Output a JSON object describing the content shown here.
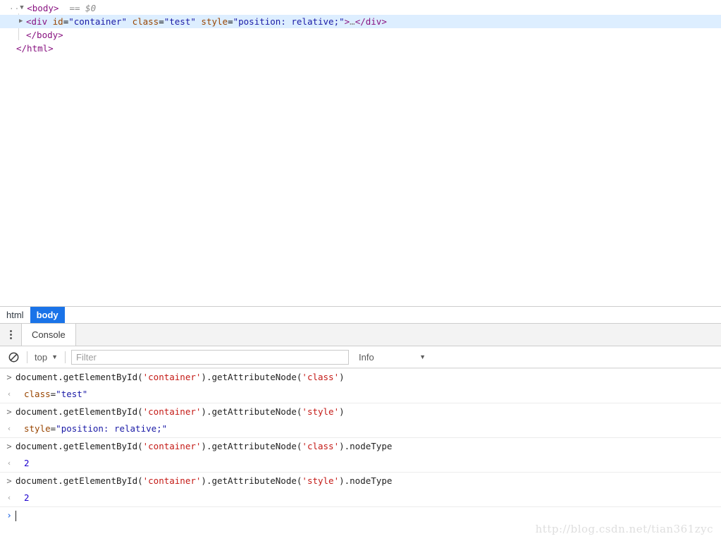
{
  "elements_panel": {
    "rows": [
      {
        "indent": 0,
        "twisty": "open",
        "leading_dots": "··",
        "selected": false,
        "segments": [
          {
            "cls": "t-tag",
            "text": "<body>"
          },
          {
            "cls": "t-plain",
            "text": "  "
          },
          {
            "cls": "t-comment",
            "text": "== $0"
          }
        ]
      },
      {
        "indent": 1,
        "twisty": "closed",
        "leading_dots": "",
        "selected": true,
        "segments": [
          {
            "cls": "t-tag",
            "text": "<div"
          },
          {
            "cls": "t-plain",
            "text": " "
          },
          {
            "cls": "t-attrname",
            "text": "id"
          },
          {
            "cls": "t-punct2",
            "text": "="
          },
          {
            "cls": "t-attrval",
            "text": "\"container\""
          },
          {
            "cls": "t-plain",
            "text": " "
          },
          {
            "cls": "t-attrname",
            "text": "class"
          },
          {
            "cls": "t-punct2",
            "text": "="
          },
          {
            "cls": "t-attrval",
            "text": "\"test\""
          },
          {
            "cls": "t-plain",
            "text": " "
          },
          {
            "cls": "t-attrname",
            "text": "style"
          },
          {
            "cls": "t-punct2",
            "text": "="
          },
          {
            "cls": "t-attrval",
            "text": "\"position: relative;\""
          },
          {
            "cls": "t-tag",
            "text": ">"
          },
          {
            "cls": "t-elide",
            "text": "…"
          },
          {
            "cls": "t-tag",
            "text": "</div>"
          }
        ]
      },
      {
        "indent": 1,
        "twisty": "none",
        "leading_dots": "",
        "selected": false,
        "segments": [
          {
            "cls": "t-tag",
            "text": "</body>"
          }
        ]
      },
      {
        "indent": 0,
        "twisty": "none",
        "leading_dots": "",
        "selected": false,
        "segments": [
          {
            "cls": "t-tag",
            "text": "</html>"
          }
        ]
      }
    ]
  },
  "breadcrumb": {
    "items": [
      {
        "label": "html",
        "active": false
      },
      {
        "label": "body",
        "active": true
      }
    ]
  },
  "drawer": {
    "kebab_icon": "more-vertical-icon",
    "tabs": [
      {
        "label": "Console",
        "active": true
      }
    ]
  },
  "console_toolbar": {
    "clear_icon": "clear-console-icon",
    "context_label": "top",
    "context_caret": "▼",
    "filter_placeholder": "Filter",
    "filter_value": "",
    "level_label": "Info",
    "level_caret": "▼"
  },
  "console_messages": [
    {
      "type": "command",
      "gutter": ">",
      "segments": [
        {
          "cls": "c-plain",
          "text": "document.getElementById("
        },
        {
          "cls": "c-str",
          "text": "'container'"
        },
        {
          "cls": "c-plain",
          "text": ").getAttributeNode("
        },
        {
          "cls": "c-str",
          "text": "'class'"
        },
        {
          "cls": "c-plain",
          "text": ")"
        }
      ]
    },
    {
      "type": "result",
      "gutter": "‹",
      "segments": [
        {
          "cls": "c-attrname",
          "text": "class"
        },
        {
          "cls": "c-plain",
          "text": "="
        },
        {
          "cls": "c-attrval",
          "text": "\"test\""
        }
      ]
    },
    {
      "type": "command",
      "gutter": ">",
      "segments": [
        {
          "cls": "c-plain",
          "text": "document.getElementById("
        },
        {
          "cls": "c-str",
          "text": "'container'"
        },
        {
          "cls": "c-plain",
          "text": ").getAttributeNode("
        },
        {
          "cls": "c-str",
          "text": "'style'"
        },
        {
          "cls": "c-plain",
          "text": ")"
        }
      ]
    },
    {
      "type": "result",
      "gutter": "‹",
      "segments": [
        {
          "cls": "c-attrname",
          "text": "style"
        },
        {
          "cls": "c-plain",
          "text": "="
        },
        {
          "cls": "c-attrval",
          "text": "\"position: relative;\""
        }
      ]
    },
    {
      "type": "command",
      "gutter": ">",
      "segments": [
        {
          "cls": "c-plain",
          "text": "document.getElementById("
        },
        {
          "cls": "c-str",
          "text": "'container'"
        },
        {
          "cls": "c-plain",
          "text": ").getAttributeNode("
        },
        {
          "cls": "c-str",
          "text": "'class'"
        },
        {
          "cls": "c-plain",
          "text": ").nodeType"
        }
      ]
    },
    {
      "type": "result",
      "gutter": "‹",
      "segments": [
        {
          "cls": "c-num",
          "text": "2"
        }
      ]
    },
    {
      "type": "command",
      "gutter": ">",
      "segments": [
        {
          "cls": "c-plain",
          "text": "document.getElementById("
        },
        {
          "cls": "c-str",
          "text": "'container'"
        },
        {
          "cls": "c-plain",
          "text": ").getAttributeNode("
        },
        {
          "cls": "c-str",
          "text": "'style'"
        },
        {
          "cls": "c-plain",
          "text": ").nodeType"
        }
      ]
    },
    {
      "type": "result",
      "gutter": "‹",
      "segments": [
        {
          "cls": "c-num",
          "text": "2"
        }
      ]
    }
  ],
  "console_prompt": {
    "chevron": "›",
    "value": ""
  },
  "watermark": {
    "text": "http://blog.csdn.net/tian361zyc"
  },
  "colors": {
    "selection_blue": "#1a73e8",
    "dom_selected_row": "#ddeeff",
    "tag_purple": "#881280",
    "attr_name_orange": "#994500",
    "attr_value_blue": "#1a1aa6",
    "string_red": "#c41a16",
    "number_blue": "#1c00cf",
    "prompt_blue": "#3b78e7",
    "watermark_gray": "#dedede"
  }
}
